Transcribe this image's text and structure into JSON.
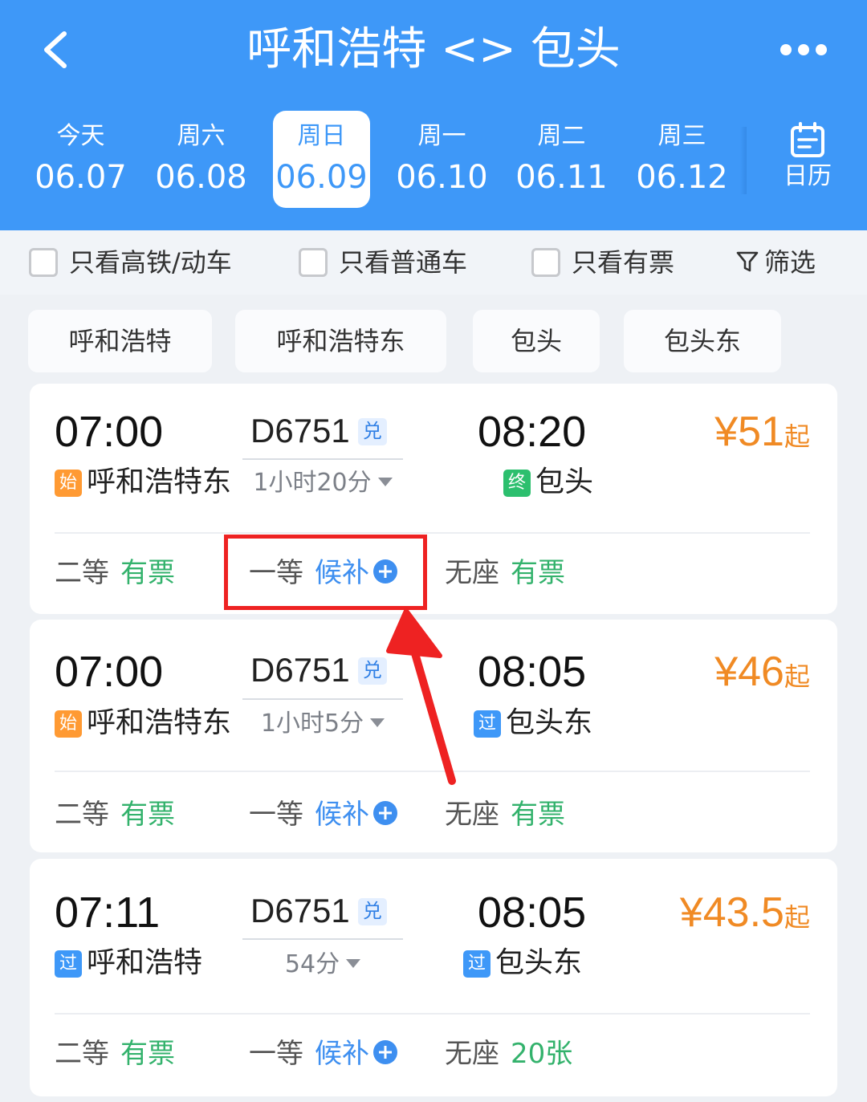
{
  "header": {
    "title": "呼和浩特 <> 包头",
    "back_icon": "chevron-left-icon",
    "more_icon": "more-dots-icon"
  },
  "date_tabs": [
    {
      "weekday": "今天",
      "date": "06.07"
    },
    {
      "weekday": "周六",
      "date": "06.08"
    },
    {
      "weekday": "周日",
      "date": "06.09",
      "selected": true
    },
    {
      "weekday": "周一",
      "date": "06.10"
    },
    {
      "weekday": "周二",
      "date": "06.11"
    },
    {
      "weekday": "周三",
      "date": "06.12"
    }
  ],
  "calendar": {
    "label": "日历",
    "icon": "calendar-icon"
  },
  "filters": {
    "high_speed": "只看高铁/动车",
    "regular": "只看普通车",
    "available": "只看有票",
    "filter_label": "筛选",
    "filter_icon": "funnel-icon"
  },
  "stations": [
    "呼和浩特",
    "呼和浩特东",
    "包头",
    "包头东"
  ],
  "trains": [
    {
      "depart_time": "07:00",
      "train_no": "D6751",
      "badge": "兑",
      "arrive_time": "08:20",
      "from_badge": "始",
      "from_station": "呼和浩特东",
      "to_badge": "终",
      "to_station": "包头",
      "duration": "1小时20分",
      "price": "¥51",
      "price_suffix": "起",
      "seats": [
        {
          "class": "二等",
          "status": "有票"
        },
        {
          "class": "一等",
          "status": "候补"
        },
        {
          "class": "无座",
          "status": "有票"
        }
      ]
    },
    {
      "depart_time": "07:00",
      "train_no": "D6751",
      "badge": "兑",
      "arrive_time": "08:05",
      "from_badge": "始",
      "from_station": "呼和浩特东",
      "to_badge": "过",
      "to_station": "包头东",
      "duration": "1小时5分",
      "price": "¥46",
      "price_suffix": "起",
      "seats": [
        {
          "class": "二等",
          "status": "有票"
        },
        {
          "class": "一等",
          "status": "候补"
        },
        {
          "class": "无座",
          "status": "有票"
        }
      ]
    },
    {
      "depart_time": "07:11",
      "train_no": "D6751",
      "badge": "兑",
      "arrive_time": "08:05",
      "from_badge": "过",
      "from_station": "呼和浩特",
      "to_badge": "过",
      "to_station": "包头东",
      "duration": "54分",
      "price": "¥43.5",
      "price_suffix": "起",
      "seats": [
        {
          "class": "二等",
          "status": "有票"
        },
        {
          "class": "一等",
          "status": "候补"
        },
        {
          "class": "无座",
          "status": "20张"
        }
      ]
    }
  ],
  "colors": {
    "header_blue": "#3e98f8",
    "price_orange": "#f08a24",
    "available_green": "#33b26c",
    "waitlist_blue": "#3e8ff0",
    "annotation_red": "#ee2222"
  }
}
